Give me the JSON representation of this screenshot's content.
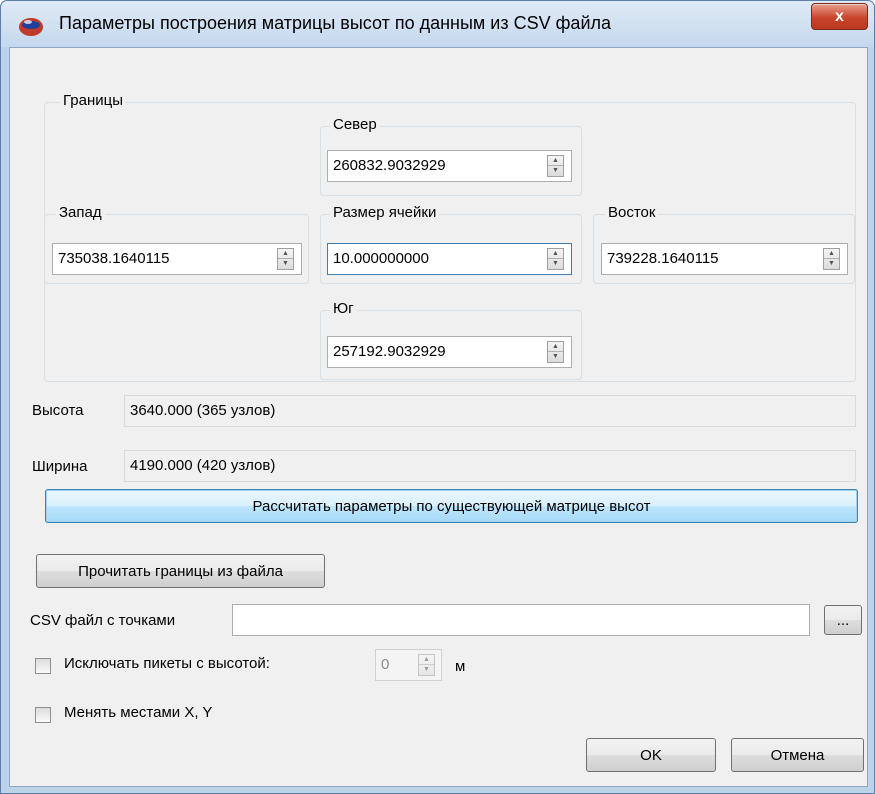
{
  "window": {
    "title": "Параметры построения матрицы высот по данным из CSV файла",
    "close_glyph": "x"
  },
  "bounds": {
    "label": "Границы",
    "north": {
      "label": "Север",
      "value": "260832.9032929"
    },
    "west": {
      "label": "Запад",
      "value": "735038.1640115"
    },
    "cell_size": {
      "label": "Размер ячейки",
      "value": "10.000000000"
    },
    "east": {
      "label": "Восток",
      "value": "739228.1640115"
    },
    "south": {
      "label": "Юг",
      "value": "257192.9032929"
    }
  },
  "height": {
    "label": "Высота",
    "value": "3640.000 (365 узлов)"
  },
  "width": {
    "label": "Ширина",
    "value": "4190.000 (420 узлов)"
  },
  "buttons": {
    "calc_from_existing": "Рассчитать параметры по существующей матрице высот",
    "read_bounds": "Прочитать границы из файла",
    "browse": "...",
    "ok": "OK",
    "cancel": "Отмена"
  },
  "csv_file": {
    "label": "CSV файл с точками",
    "value": ""
  },
  "exclude_pickets": {
    "label": "Исключать пикеты с высотой:",
    "checked": false,
    "value": "0",
    "unit": "м"
  },
  "swap_xy": {
    "label": "Менять местами X, Y",
    "checked": false
  },
  "colors": {
    "accent_border": "#3c7fb1",
    "titlebar": "#c5d8ee",
    "close_button": "#c9452b",
    "dialog_bg": "#f0f0f0"
  },
  "icons": {
    "app": "app-sphere-icon",
    "spin_up": "arrow-up-icon",
    "spin_down": "arrow-down-icon"
  }
}
